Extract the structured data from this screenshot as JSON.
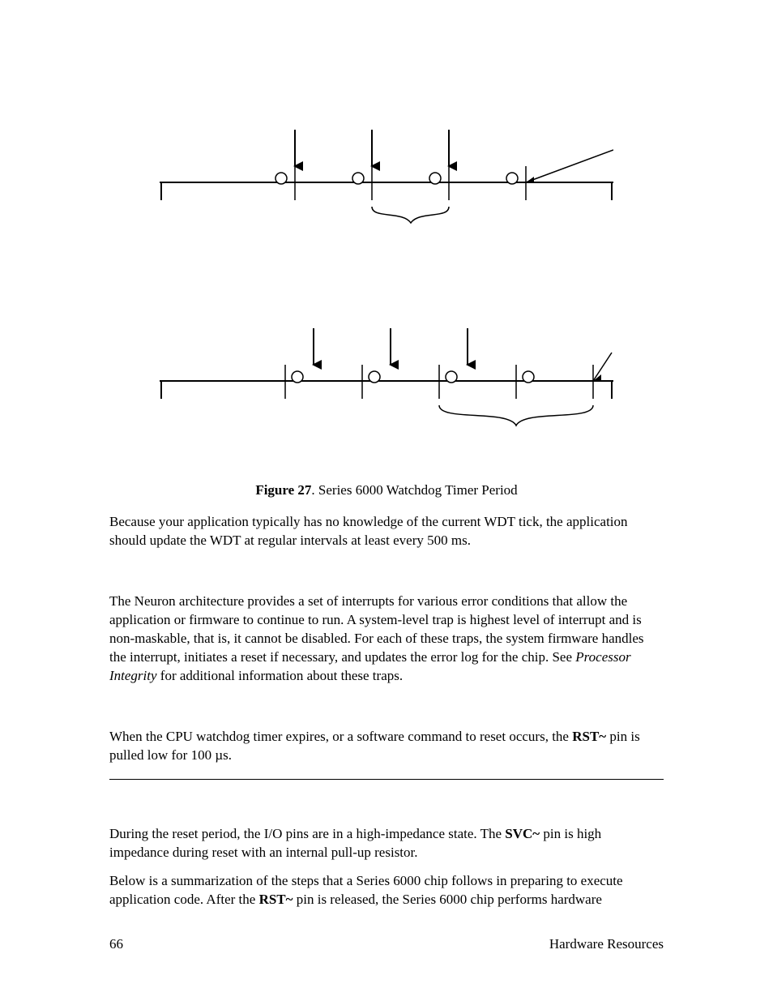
{
  "figure": {
    "label": "Figure 27",
    "caption_rest": ". Series 6000 Watchdog Timer Period"
  },
  "paragraphs": {
    "p1": "Because your application typically has no knowledge of the current WDT tick, the application should update the WDT at regular intervals at least every 500 ms.",
    "p2": "The Neuron architecture provides a set of interrupts for various error conditions that allow the application or firmware to continue to run.  A system-level trap is highest level of interrupt and is non-maskable, that is, it cannot be disabled.  For each of these traps, the system firmware handles the interrupt, initiates a reset if necessary, and updates the error log for the chip.  See ",
    "p2_ital": "Processor Integrity",
    "p2_tail": " for additional information about these traps.",
    "p3_head": "When the CPU watchdog timer expires, or a software command to reset occurs, the ",
    "p3_bold": "RST~",
    "p3_tail": " pin is pulled low for 100 µs.",
    "p4_head": "During the reset period, the I/O pins are in a high-impedance state.  The ",
    "p4_bold": "SVC~",
    "p4_tail": " pin is high impedance during reset with an internal pull-up resistor.",
    "p5_head": "Below is a summarization of the steps that a Series 6000 chip follows in preparing to execute application code.  After the ",
    "p5_bold": "RST~",
    "p5_tail": " pin is released, the Series 6000 chip performs hardware"
  },
  "footer": {
    "page_number": "66",
    "section": "Hardware Resources"
  },
  "chart_data": {
    "type": "diagram",
    "description": "Two timing diagrams illustrating watchdog timer update events relative to WDT ticks (open circles). Three consecutive updates (arrows) land between ticks; a bracket spans one inter-tick interval in the upper diagram and roughly two in the lower, with an angled callout line pointing at a later tick.",
    "diagrams": [
      {
        "ticks_shown": 4,
        "update_arrows": 3,
        "bracket_span_ticks": 1,
        "callout_line": true
      },
      {
        "ticks_shown": 4,
        "update_arrows": 3,
        "bracket_span_ticks": 2,
        "callout_line": true
      }
    ]
  }
}
